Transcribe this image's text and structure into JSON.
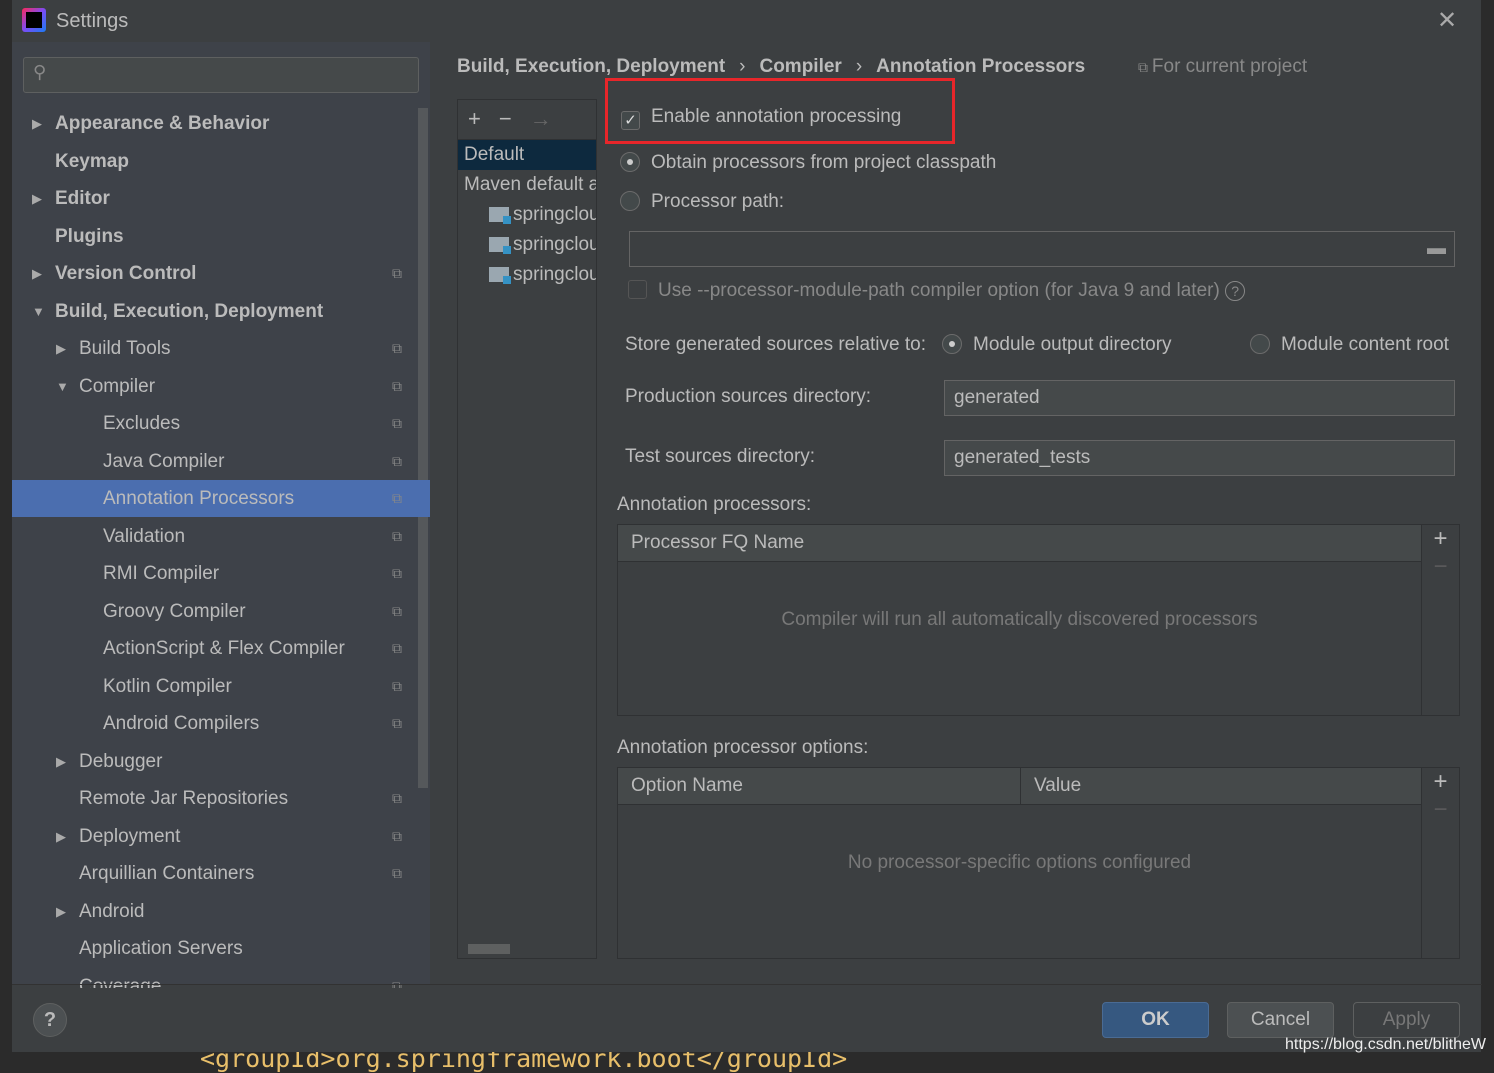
{
  "window": {
    "title": "Settings",
    "close": "✕"
  },
  "sidebar": {
    "items": [
      {
        "label": "Appearance & Behavior",
        "arrow": "▶",
        "bold": true,
        "indent": 0
      },
      {
        "label": "Keymap",
        "bold": true,
        "indent": 0
      },
      {
        "label": "Editor",
        "arrow": "▶",
        "bold": true,
        "indent": 0
      },
      {
        "label": "Plugins",
        "bold": true,
        "indent": 0
      },
      {
        "label": "Version Control",
        "arrow": "▶",
        "bold": true,
        "indent": 0,
        "copy": true
      },
      {
        "label": "Build, Execution, Deployment",
        "arrow": "▼",
        "bold": true,
        "indent": 0
      },
      {
        "label": "Build Tools",
        "arrow": "▶",
        "indent": 1,
        "copy": true
      },
      {
        "label": "Compiler",
        "arrow": "▼",
        "indent": 1,
        "copy": true
      },
      {
        "label": "Excludes",
        "indent": 2,
        "copy": true
      },
      {
        "label": "Java Compiler",
        "indent": 2,
        "copy": true
      },
      {
        "label": "Annotation Processors",
        "indent": 2,
        "copy": true,
        "selected": true
      },
      {
        "label": "Validation",
        "indent": 2,
        "copy": true
      },
      {
        "label": "RMI Compiler",
        "indent": 2,
        "copy": true
      },
      {
        "label": "Groovy Compiler",
        "indent": 2,
        "copy": true
      },
      {
        "label": "ActionScript & Flex Compiler",
        "indent": 2,
        "copy": true
      },
      {
        "label": "Kotlin Compiler",
        "indent": 2,
        "copy": true
      },
      {
        "label": "Android Compilers",
        "indent": 2,
        "copy": true
      },
      {
        "label": "Debugger",
        "arrow": "▶",
        "indent": 1
      },
      {
        "label": "Remote Jar Repositories",
        "indent": 1,
        "copy": true
      },
      {
        "label": "Deployment",
        "arrow": "▶",
        "indent": 1,
        "copy": true
      },
      {
        "label": "Arquillian Containers",
        "indent": 1,
        "copy": true
      },
      {
        "label": "Android",
        "arrow": "▶",
        "indent": 1
      },
      {
        "label": "Application Servers",
        "indent": 1
      },
      {
        "label": "Coverage",
        "indent": 1,
        "copy": true
      }
    ]
  },
  "breadcrumb": [
    "Build, Execution, Deployment",
    "Compiler",
    "Annotation Processors"
  ],
  "scope": "For current project",
  "profiles": {
    "toolbar": [
      "+",
      "−",
      "→"
    ],
    "items": [
      "Default",
      "Maven default annotation processors profile"
    ],
    "modules": [
      "springcloud",
      "springcloud",
      "springcloud"
    ]
  },
  "form": {
    "enable": "Enable annotation processing",
    "enable_checked": true,
    "obtain": "Obtain processors from project classpath",
    "processor_path": "Processor path:",
    "processor_path_value": "",
    "module_path": "Use --processor-module-path compiler option (for Java 9 and later)",
    "store_label": "Store generated sources relative to:",
    "store_opt1": "Module output directory",
    "store_opt2": "Module content root",
    "prod_label": "Production sources directory:",
    "prod_value": "generated",
    "test_label": "Test sources directory:",
    "test_value": "generated_tests",
    "ap_label": "Annotation processors:",
    "ap_col": "Processor FQ Name",
    "ap_empty": "Compiler will run all automatically discovered processors",
    "opt_label": "Annotation processor options:",
    "opt_col1": "Option Name",
    "opt_col2": "Value",
    "opt_empty": "No processor-specific options configured"
  },
  "buttons": {
    "ok": "OK",
    "cancel": "Cancel",
    "apply": "Apply",
    "help": "?"
  },
  "background": {
    "code": "<groupId>org.springframework.boot</groupId>",
    "watermark": "https://blog.csdn.net/blitheW"
  },
  "colors": {
    "selection": "#4b6eaf",
    "highlight_box": "#e8262a",
    "ok": "#365880"
  }
}
